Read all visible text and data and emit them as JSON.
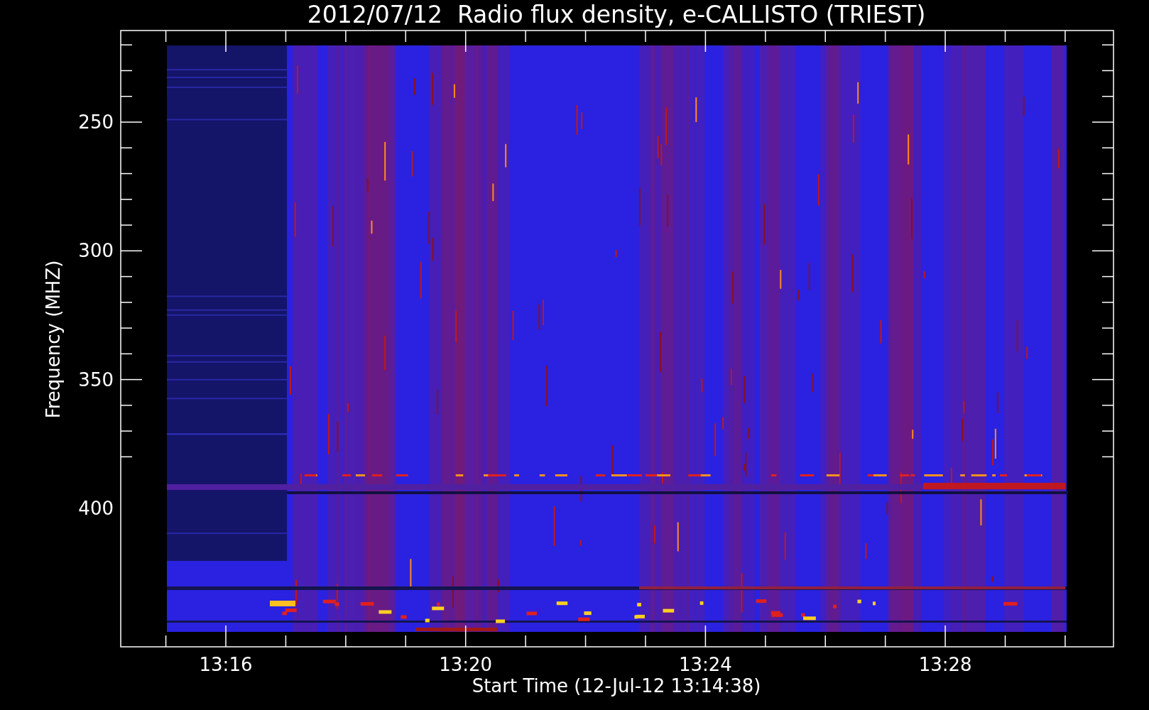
{
  "title": "2012/07/12  Radio flux density, e-CALLISTO (TRIEST)",
  "y_axis": {
    "label": "Frequency (MHZ)",
    "ticks": [
      "250",
      "300",
      "350",
      "400"
    ]
  },
  "x_axis": {
    "label": "Start Time (12-Jul-12 13:14:38)",
    "ticks": [
      "13:16",
      "13:20",
      "13:24",
      "13:28"
    ]
  }
}
